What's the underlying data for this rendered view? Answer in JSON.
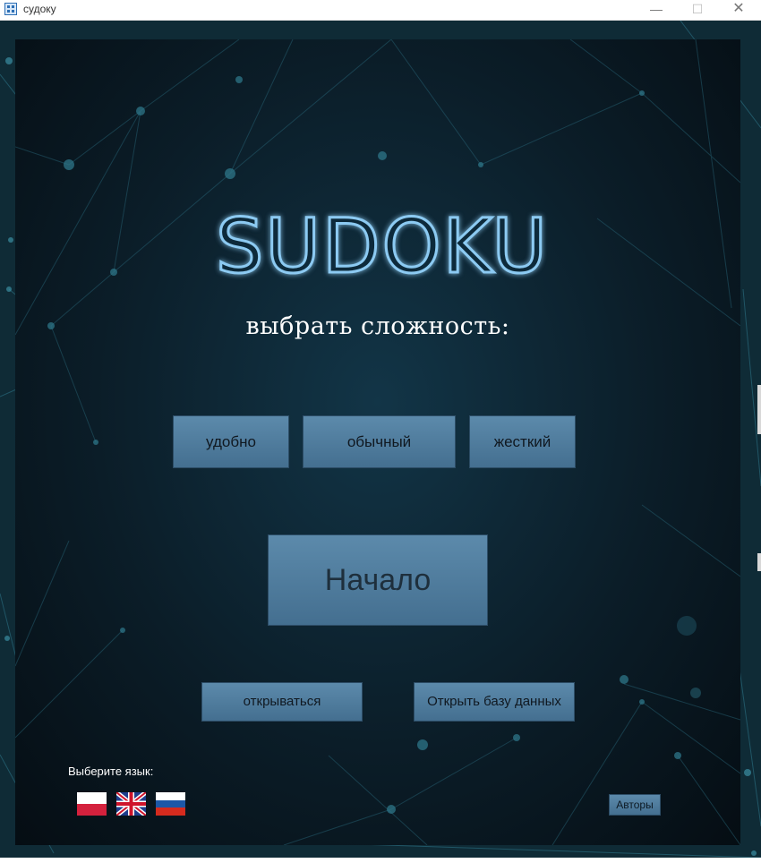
{
  "window": {
    "title": "судоку",
    "minimize_symbol": "—",
    "maximize_symbol": "☐",
    "close_symbol": "✕"
  },
  "main": {
    "logo_text": "SUDOKU",
    "subtitle": "выбрать сложность:",
    "difficulty_buttons": [
      "удобно",
      "обычный",
      "жесткий"
    ],
    "start_button": "Начало",
    "open_button": "открываться",
    "open_db_button": "Открыть базу данных",
    "language_label": "Выберите язык:",
    "flags": [
      "poland-flag-icon",
      "uk-flag-icon",
      "russia-flag-icon"
    ],
    "authors_button": "Авторы"
  },
  "colors": {
    "button": "#517d9e",
    "panel": "#0b1d28",
    "logo_stroke": "#7fc0ee"
  }
}
